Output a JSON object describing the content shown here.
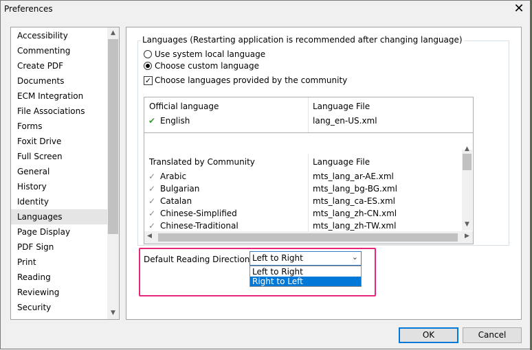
{
  "window": {
    "title": "Preferences",
    "close_glyph": "✕"
  },
  "sidebar": {
    "items": [
      {
        "label": "Accessibility"
      },
      {
        "label": "Commenting"
      },
      {
        "label": "Create PDF"
      },
      {
        "label": "Documents"
      },
      {
        "label": "ECM Integration"
      },
      {
        "label": "File Associations"
      },
      {
        "label": "Forms"
      },
      {
        "label": "Foxit Drive"
      },
      {
        "label": "Full Screen"
      },
      {
        "label": "General"
      },
      {
        "label": "History"
      },
      {
        "label": "Identity"
      },
      {
        "label": "Languages"
      },
      {
        "label": "Page Display"
      },
      {
        "label": "PDF Sign"
      },
      {
        "label": "Print"
      },
      {
        "label": "Reading"
      },
      {
        "label": "Reviewing"
      },
      {
        "label": "Security"
      }
    ],
    "selected": "Languages"
  },
  "languages": {
    "group_title": "Languages (Restarting application is recommended after changing language)",
    "use_system": "Use system local language",
    "choose_custom": "Choose custom language",
    "community_check": "Choose languages provided by the community",
    "official": {
      "col1": "Official language",
      "col2": "Language File",
      "rows": [
        {
          "name": "English",
          "file": "lang_en-US.xml"
        }
      ]
    },
    "community": {
      "col1": "Translated by Community",
      "col2": "Language File",
      "rows": [
        {
          "name": "Arabic",
          "file": "mts_lang_ar-AE.xml"
        },
        {
          "name": "Bulgarian",
          "file": "mts_lang_bg-BG.xml"
        },
        {
          "name": "Catalan",
          "file": "mts_lang_ca-ES.xml"
        },
        {
          "name": "Chinese-Simplified",
          "file": "mts_lang_zh-CN.xml"
        },
        {
          "name": "Chinese-Traditional",
          "file": "mts_lang_zh-TW.xml"
        }
      ]
    }
  },
  "reading_direction": {
    "label": "Default Reading Direction:",
    "value": "Left to Right",
    "options": [
      "Left to Right",
      "Right to Left"
    ],
    "highlighted": "Right to Left"
  },
  "buttons": {
    "ok": "OK",
    "cancel": "Cancel"
  },
  "colors": {
    "accent": "#0078d7",
    "highlight_box": "#e8257a",
    "check_green": "#3a9a3a"
  },
  "icons": {
    "check": "✔",
    "check_gray": "✓",
    "up": "▲",
    "down": "▼",
    "left": "◀",
    "right": "▶",
    "chevron": "⌄"
  }
}
